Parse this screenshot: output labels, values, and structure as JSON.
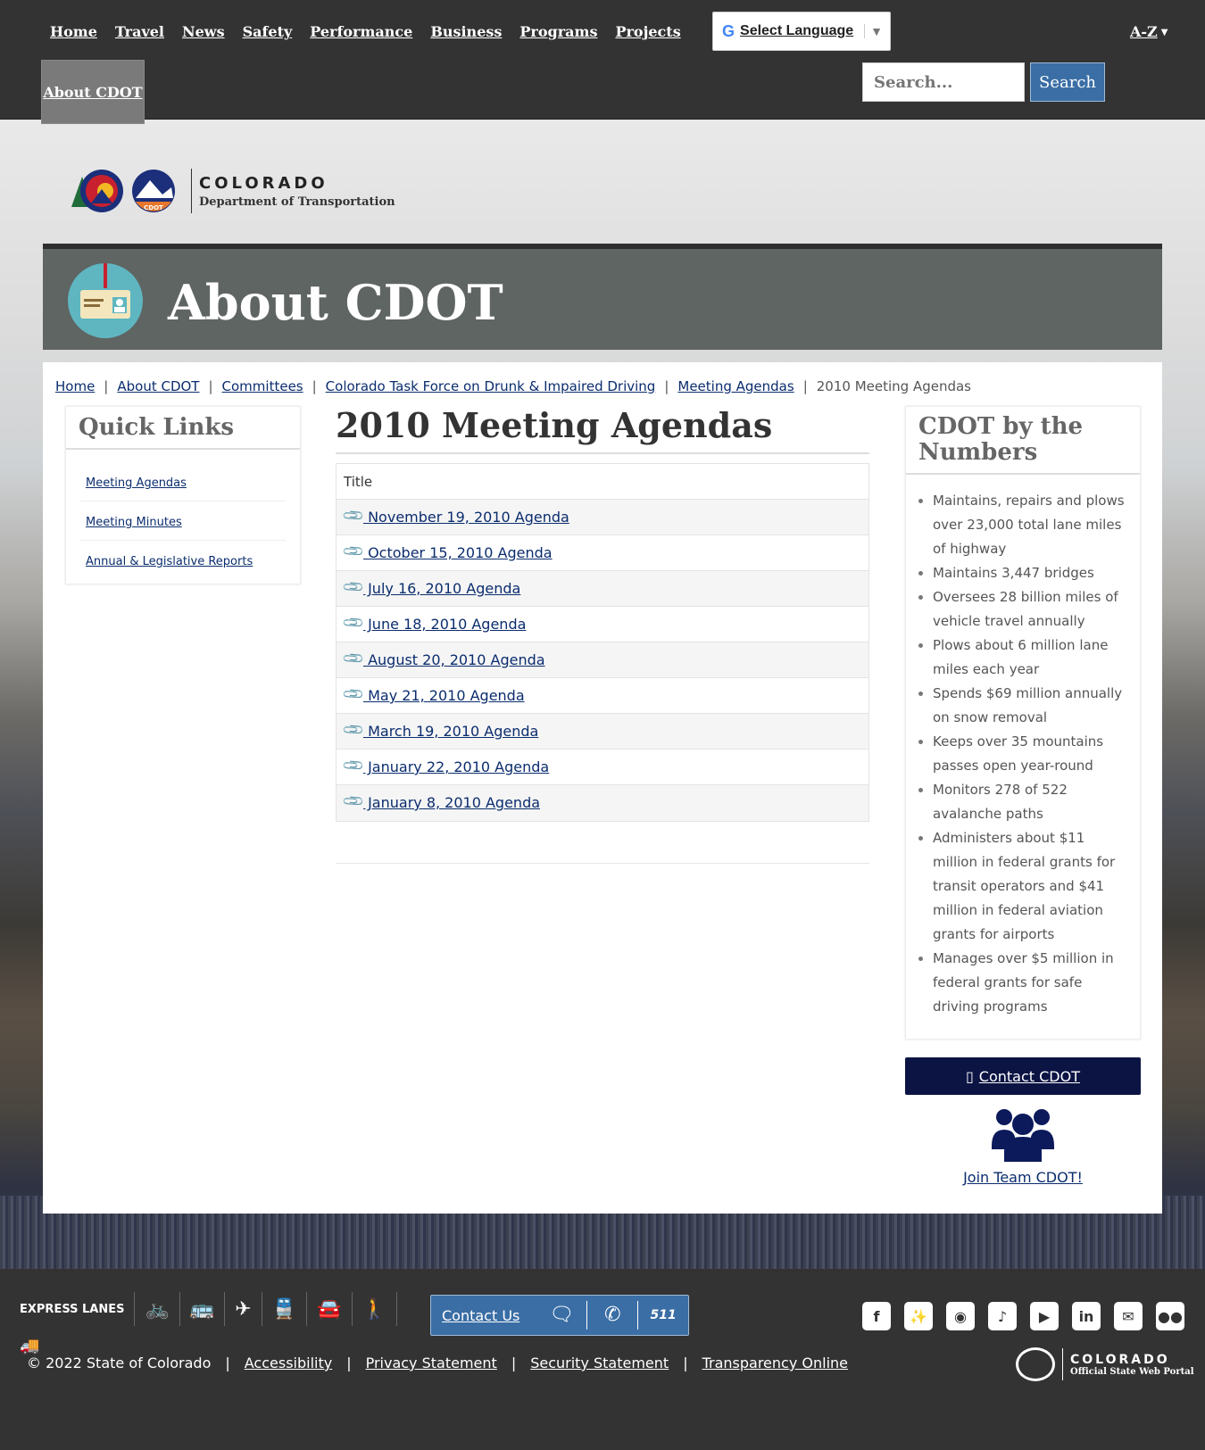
{
  "nav": {
    "items": [
      "Home",
      "Travel",
      "News",
      "Safety",
      "Performance",
      "Business",
      "Programs",
      "Projects"
    ],
    "active": "About CDOT",
    "language_label": "Select Language",
    "az_label": "A-Z",
    "search_placeholder": "Search...",
    "search_button": "Search"
  },
  "logo": {
    "state": "COLORADO",
    "dept": "Department of Transportation"
  },
  "banner": {
    "title": "About CDOT"
  },
  "breadcrumb": {
    "links": [
      "Home",
      "About CDOT",
      "Committees",
      "Colorado Task Force on Drunk & Impaired Driving",
      "Meeting Agendas"
    ],
    "current": "2010 Meeting Agendas"
  },
  "quick_links": {
    "title": "Quick Links",
    "items": [
      "Meeting Agendas",
      "Meeting Minutes",
      "Annual & Legislative Reports"
    ]
  },
  "main": {
    "title": "2010 Meeting Agendas",
    "column_header": "Title",
    "rows": [
      " November 19, 2010 Agenda",
      " October 15, 2010 Agenda",
      " July 16, 2010 Agenda",
      " June 18, 2010 Agenda",
      " August 20, 2010 Agenda",
      " May 21, 2010 Agenda",
      " March 19, 2010 Agenda",
      " January 22, 2010 Agenda",
      " January 8, 2010 Agenda"
    ]
  },
  "numbers": {
    "title": "CDOT by the Numbers",
    "items": [
      "Maintains, repairs and plows over 23,000 total lane miles of highway",
      "Maintains 3,447 bridges",
      "Oversees 28 billion miles of vehicle travel annually",
      "Plows about 6 million lane miles each year",
      "Spends $69 million annually on snow removal",
      "Keeps over 35 mountains passes open year-round",
      "Monitors 278 of 522 avalanche paths",
      "Administers about $11 million in federal grants for transit operators and $41 million in federal aviation grants for airports",
      "Manages over $5 million in federal grants for safe driving programs"
    ]
  },
  "sidebar_actions": {
    "contact": "Contact CDOT",
    "join": "Join Team CDOT!"
  },
  "footer": {
    "express_lanes": "EXPRESS LANES",
    "contact_label": "Contact Us",
    "contact_511": "511",
    "copyright": "© 2022 State of Colorado",
    "links": [
      "Accessibility",
      "Privacy Statement",
      "Security Statement",
      "Transparency Online"
    ],
    "portal_state": "COLORADO",
    "portal_sub": "Official State Web Portal",
    "social": [
      "facebook-icon",
      "twitter-icon",
      "instagram-icon",
      "tiktok-icon",
      "youtube-icon",
      "linkedin-icon",
      "email-icon",
      "flickr-icon"
    ]
  },
  "colors": {
    "nav_bg": "#333333",
    "link": "#0b2d6e",
    "search_button": "#3a6ea5",
    "contact_button": "#0c1444",
    "banner": "#5f6563"
  }
}
